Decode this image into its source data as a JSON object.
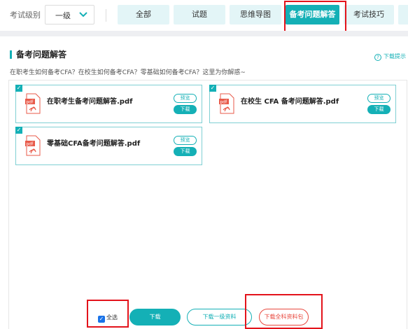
{
  "filter": {
    "level_label": "考试级别",
    "level_value": "一级"
  },
  "tabs": [
    {
      "label": "全部"
    },
    {
      "label": "试题"
    },
    {
      "label": "思维导图"
    },
    {
      "label": "备考问题解答"
    },
    {
      "label": "考试技巧"
    }
  ],
  "active_tab_index": 3,
  "section": {
    "title": "备考问题解答",
    "tip": "下载提示",
    "description": "在职考生如何备考CFA？在校生如何备考CFA？零基础如何备考CFA？这里为你解惑~"
  },
  "files": [
    {
      "name": "在职考生备考问题解答.pdf",
      "preview": "预览",
      "download": "下载",
      "checked": true
    },
    {
      "name": "在校生 CFA 备考问题解答.pdf",
      "preview": "预览",
      "download": "下载",
      "checked": true
    },
    {
      "name": "零基础CFA备考问题解答.pdf",
      "preview": "预览",
      "download": "下载",
      "checked": true
    }
  ],
  "footer": {
    "select_all": "全选",
    "select_all_checked": true,
    "download": "下载",
    "download_level1": "下载一级资料",
    "download_all": "下载全科资料包"
  },
  "colors": {
    "accent": "#14b0b6",
    "highlight": "#e3131b"
  },
  "icons": [
    "chevron-down-icon",
    "help-icon",
    "pdf-file-icon",
    "checkmark-icon"
  ]
}
